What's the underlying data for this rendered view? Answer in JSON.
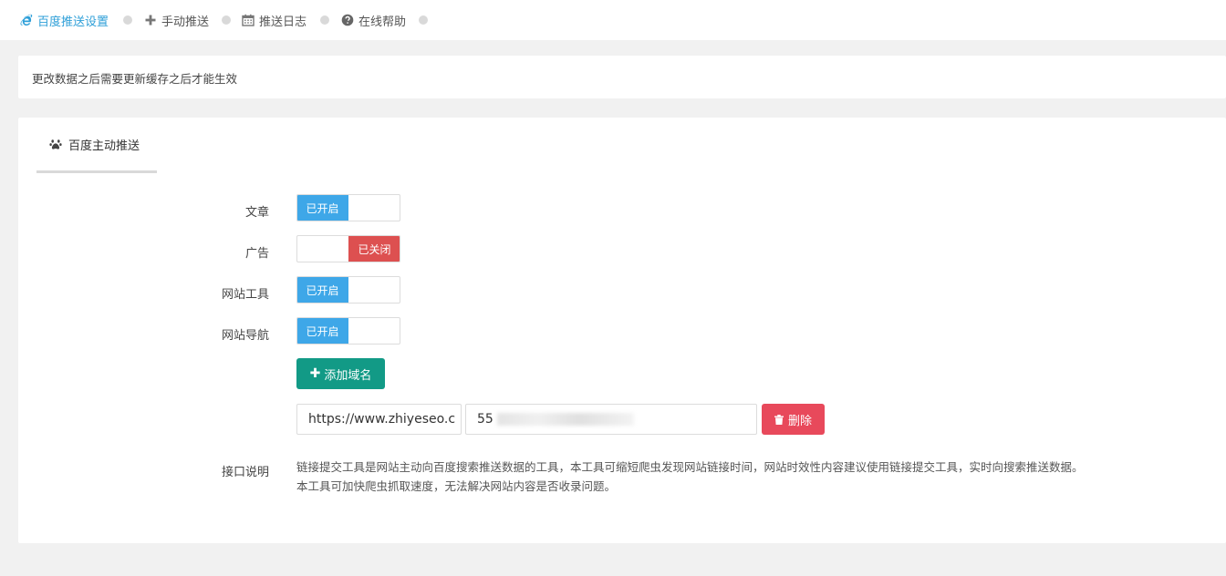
{
  "nav": {
    "items": [
      {
        "label": "百度推送设置",
        "icon": "ie-icon"
      },
      {
        "label": "手动推送",
        "icon": "plus-icon"
      },
      {
        "label": "推送日志",
        "icon": "calendar-icon"
      },
      {
        "label": "在线帮助",
        "icon": "question-icon"
      }
    ],
    "active_color": "#2e9fd8"
  },
  "notice": {
    "text": "更改数据之后需要更新缓存之后才能生效"
  },
  "tab": {
    "label": "百度主动推送",
    "icon": "paw-icon"
  },
  "settings": [
    {
      "label": "文章",
      "state": "on",
      "state_label": "已开启"
    },
    {
      "label": "广告",
      "state": "off",
      "state_label": "已关闭"
    },
    {
      "label": "网站工具",
      "state": "on",
      "state_label": "已开启"
    },
    {
      "label": "网站导航",
      "state": "on",
      "state_label": "已开启"
    }
  ],
  "add_domain_button": {
    "label": "添加域名"
  },
  "domain_row": {
    "url_value": "https://www.zhiyeseo.c",
    "token_value": "55",
    "delete_label": "删除"
  },
  "api": {
    "label": "接口说明",
    "line1": "链接提交工具是网站主动向百度搜索推送数据的工具，本工具可缩短爬虫发现网站链接时间，网站时效性内容建议使用链接提交工具，实时向搜索推送数据。",
    "line2": "本工具可加快爬虫抓取速度，无法解决网站内容是否收录问题。"
  },
  "colors": {
    "switch_on": "#3ea7e8",
    "switch_off": "#dd5050",
    "add_button": "#129a86",
    "delete_button": "#e8495b"
  }
}
